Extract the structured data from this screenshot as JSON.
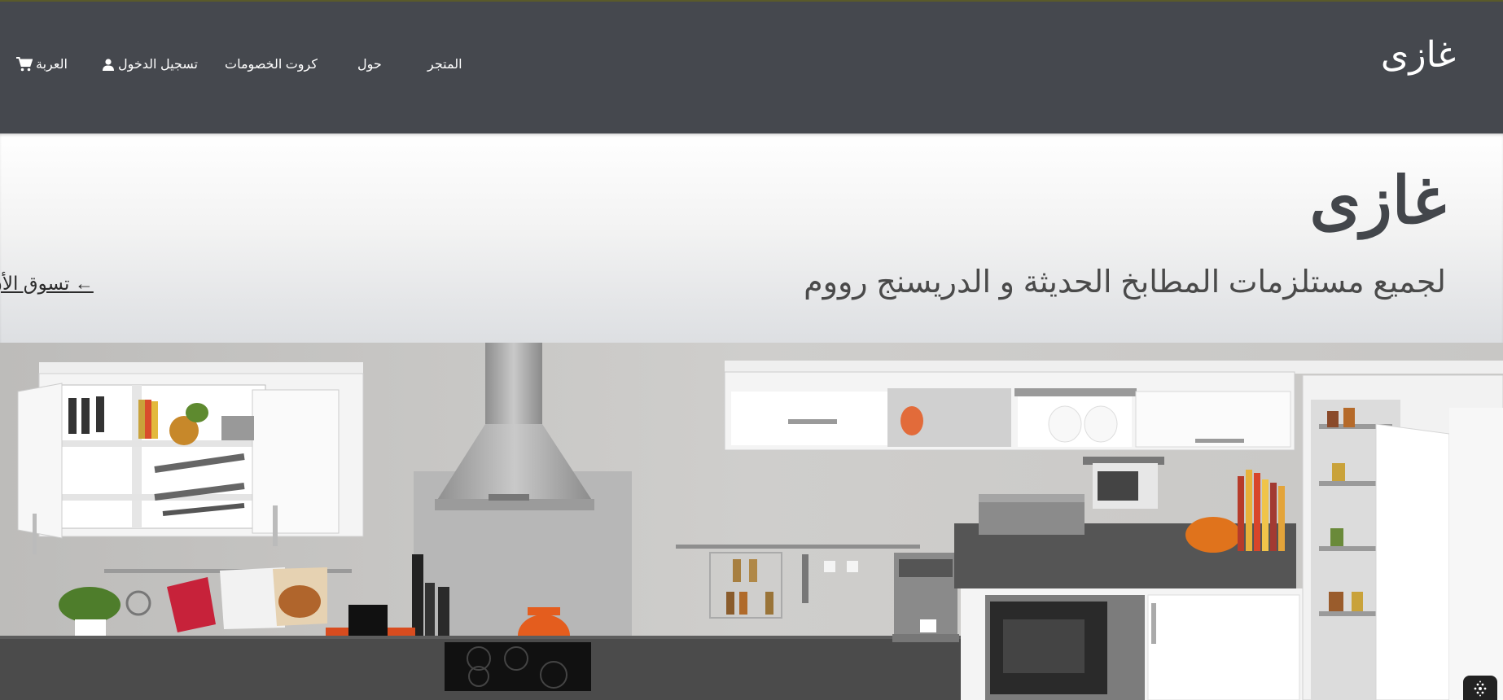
{
  "nav": {
    "brand": "غازى",
    "store": "المتجر",
    "about": "حول",
    "coupons": "كروت الخصومات",
    "login": "تسجيل الدخول",
    "cart": "العربة"
  },
  "hero": {
    "title": "غازى",
    "subtitle": "لجميع مستلزمات المطابخ الحديثة و الدريسنج رووم",
    "cta": "تسوق الأن ←"
  },
  "icons": {
    "cart": "shopping-cart-icon",
    "user": "user-icon",
    "fab": "grid-dots-icon"
  },
  "colors": {
    "navbar": "#45484e",
    "hero_text": "#43464b",
    "nav_text": "#ffffff"
  }
}
